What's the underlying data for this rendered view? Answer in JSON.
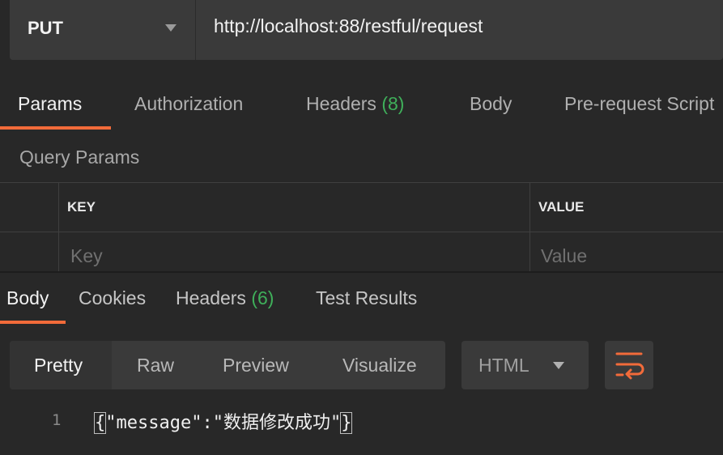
{
  "request": {
    "method": "PUT",
    "url": "http://localhost:88/restful/request"
  },
  "request_tabs": [
    {
      "label": "Params",
      "count": ""
    },
    {
      "label": "Authorization",
      "count": ""
    },
    {
      "label": "Headers",
      "count": "(8)"
    },
    {
      "label": "Body",
      "count": ""
    },
    {
      "label": "Pre-request Script",
      "count": ""
    }
  ],
  "params": {
    "section_label": "Query Params",
    "columns": [
      "KEY",
      "VALUE"
    ],
    "key_placeholder": "Key",
    "value_placeholder": "Value"
  },
  "response_tabs": [
    {
      "label": "Body",
      "count": ""
    },
    {
      "label": "Cookies",
      "count": ""
    },
    {
      "label": "Headers",
      "count": "(6)"
    },
    {
      "label": "Test Results",
      "count": ""
    }
  ],
  "view_modes": [
    "Pretty",
    "Raw",
    "Preview",
    "Visualize"
  ],
  "format": {
    "selected": "HTML"
  },
  "code": {
    "line_number": "1",
    "open_brace": "{",
    "body": "\"message\":\"数据修改成功\"",
    "close_brace": "}"
  },
  "colors": {
    "accent": "#f26b3a",
    "count_green": "#3faf5a",
    "background": "#282828"
  },
  "icons": [
    "chevron-down-icon",
    "wrap-lines-icon"
  ]
}
